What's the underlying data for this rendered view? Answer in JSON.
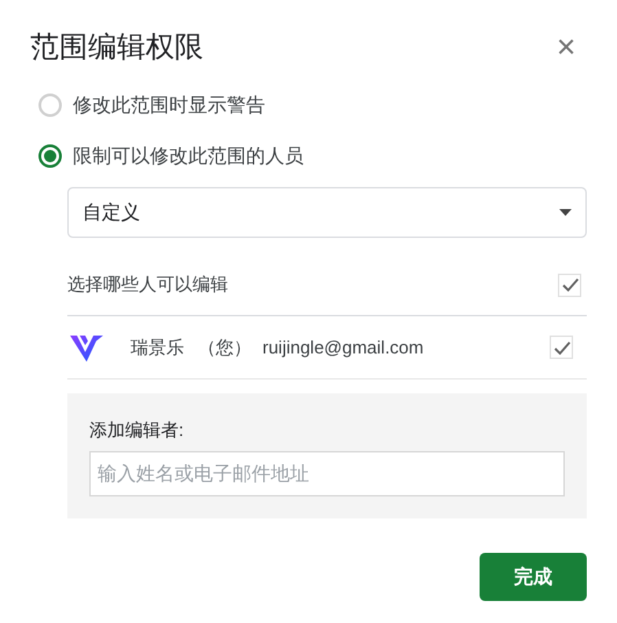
{
  "dialog": {
    "title": "范围编辑权限",
    "close": "×"
  },
  "options": [
    {
      "label": "修改此范围时显示警告",
      "selected": false
    },
    {
      "label": "限制可以修改此范围的人员",
      "selected": true
    }
  ],
  "dropdown": {
    "value": "自定义"
  },
  "editors_header": {
    "label": "选择哪些人可以编辑",
    "checked": true
  },
  "editors": [
    {
      "name": "瑞景乐",
      "note": "（您）",
      "email": "ruijingle@gmail.com",
      "checked": true
    }
  ],
  "add_editor": {
    "label": "添加编辑者:",
    "placeholder": "输入姓名或电子邮件地址"
  },
  "buttons": [
    {
      "label": "完成",
      "kind": "primary"
    }
  ]
}
